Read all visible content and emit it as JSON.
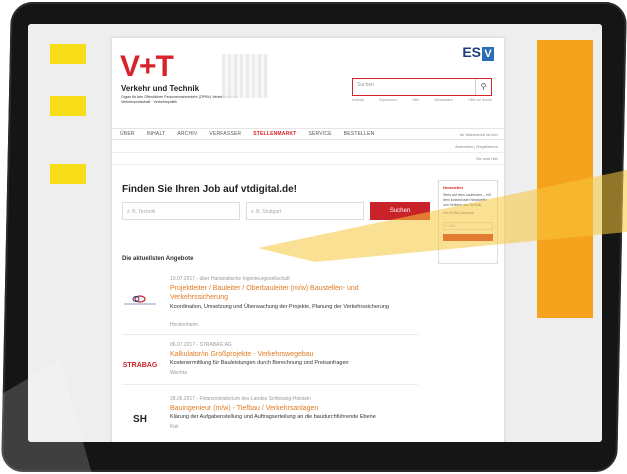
{
  "brand": {
    "logo": "V+T",
    "name": "Verkehr und Technik",
    "tagline": "Organ für den Öffentlichen Personennahverkehr (ÖPNV) Verkehrstechnik · Verkehrswirtschaft · Verkehrspolitik",
    "publisher": "ES",
    "publisher_mark": "V"
  },
  "search": {
    "placeholder": "Suchen",
    "links": [
      "Kontakt",
      "Impressum",
      "Hilfe",
      "Mediadaten",
      "Hilfe zur Suche"
    ]
  },
  "nav": {
    "items": [
      "ÜBER",
      "INHALT",
      "ARCHIV",
      "VERFASSER",
      "STELLENMARKT",
      "SERVICE",
      "BESTELLEN"
    ],
    "active": "STELLENMARKT",
    "right": "Ihr Warenkorb ist leer",
    "login": "Anmelden | Registrieren",
    "sub": "Sie sind hier"
  },
  "main": {
    "headline": "Finden Sie Ihren Job auf vtdigital.de!",
    "field1_placeholder": "z. B. Technik",
    "field2_placeholder": "z. B. Stuttgart",
    "find_button": "Suchen",
    "section_title": "Die aktuellsten Angebote"
  },
  "newsletter": {
    "title": "Newsletter",
    "text": "Stets auf dem Laufenden – mit dem kostenlosen Newsletter von Verkehr und Technik.",
    "email_label": "Ihre E-Mail-Adresse",
    "email_placeholder": "E-Mail"
  },
  "jobs": [
    {
      "meta": "13.07.2017 - über Hanseatische Ingenieurgesellschaft",
      "title": "Projektleiter / Bauleiter / Oberbauleiter (m/w) Baustellen- und Verkehrssicherung",
      "desc": "Koordination, Umsetzung und Überwachung der Projekte, Planung der Verkehrssicherung",
      "location": "Hockenheim",
      "logo": "logo-1"
    },
    {
      "meta": "06.07.2017 - STRABAG AG",
      "title": "Kalkulator/in Großprojekte - Verkehrswegebau",
      "desc": "Kostenermittlung für Bauleistungen durch Berechnung und Preisanfragen",
      "location": "Wechta",
      "logo": "STRABAG"
    },
    {
      "meta": "28.06.2017 - Finanzministerium des Landes Schleswig-Holstein",
      "title": "Bauingenieur (m/w) - Tiefbau / Verkehrsanlagen",
      "desc": "Klärung der Aufgabenstellung und Auftragserteilung an die baudurchführende Ebene",
      "location": "Kiel",
      "logo": "SH"
    }
  ],
  "colors": {
    "accent": "#d8232a",
    "orange": "#f5a31d",
    "yellow": "#f7de18",
    "link": "#e07b22"
  }
}
